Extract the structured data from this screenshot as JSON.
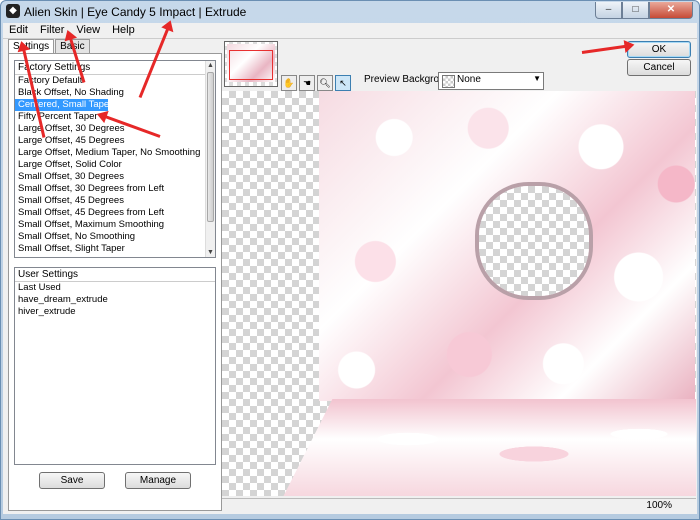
{
  "window": {
    "title": "Alien Skin | Eye Candy 5 Impact | Extrude",
    "caption_buttons": [
      "–",
      "□",
      "✕"
    ]
  },
  "menu": [
    "Edit",
    "Filter",
    "View",
    "Help"
  ],
  "tabs": [
    "Settings",
    "Basic"
  ],
  "factory_settings": {
    "header": "Factory Settings",
    "items": [
      "Factory Default",
      "Black Offset, No Shading",
      "Centered, Small Taper",
      "Fifty Percent Taper",
      "Large Offset, 30 Degrees",
      "Large Offset, 45 Degrees",
      "Large Offset, Medium Taper, No Smoothing",
      "Large Offset, Solid Color",
      "Small Offset, 30 Degrees",
      "Small Offset, 30 Degrees from Left",
      "Small Offset, 45 Degrees",
      "Small Offset, 45 Degrees from Left",
      "Small Offset, Maximum Smoothing",
      "Small Offset, No Smoothing",
      "Small Offset, Slight Taper"
    ],
    "selected": "Centered, Small Taper"
  },
  "user_settings": {
    "header": "User Settings",
    "items": [
      "Last Used",
      "have_dream_extrude",
      "hiver_extrude"
    ]
  },
  "buttons": {
    "save": "Save",
    "manage": "Manage",
    "ok": "OK",
    "cancel": "Cancel"
  },
  "preview": {
    "background_label": "Preview Background:",
    "background_value": "None",
    "tools": [
      "hand-tool-icon",
      "zoom-tool-icon",
      "select-tool-icon"
    ]
  },
  "status": {
    "zoom": "100%"
  },
  "colors": {
    "selection": "#3399ff",
    "annotation_arrow": "#e62828"
  }
}
